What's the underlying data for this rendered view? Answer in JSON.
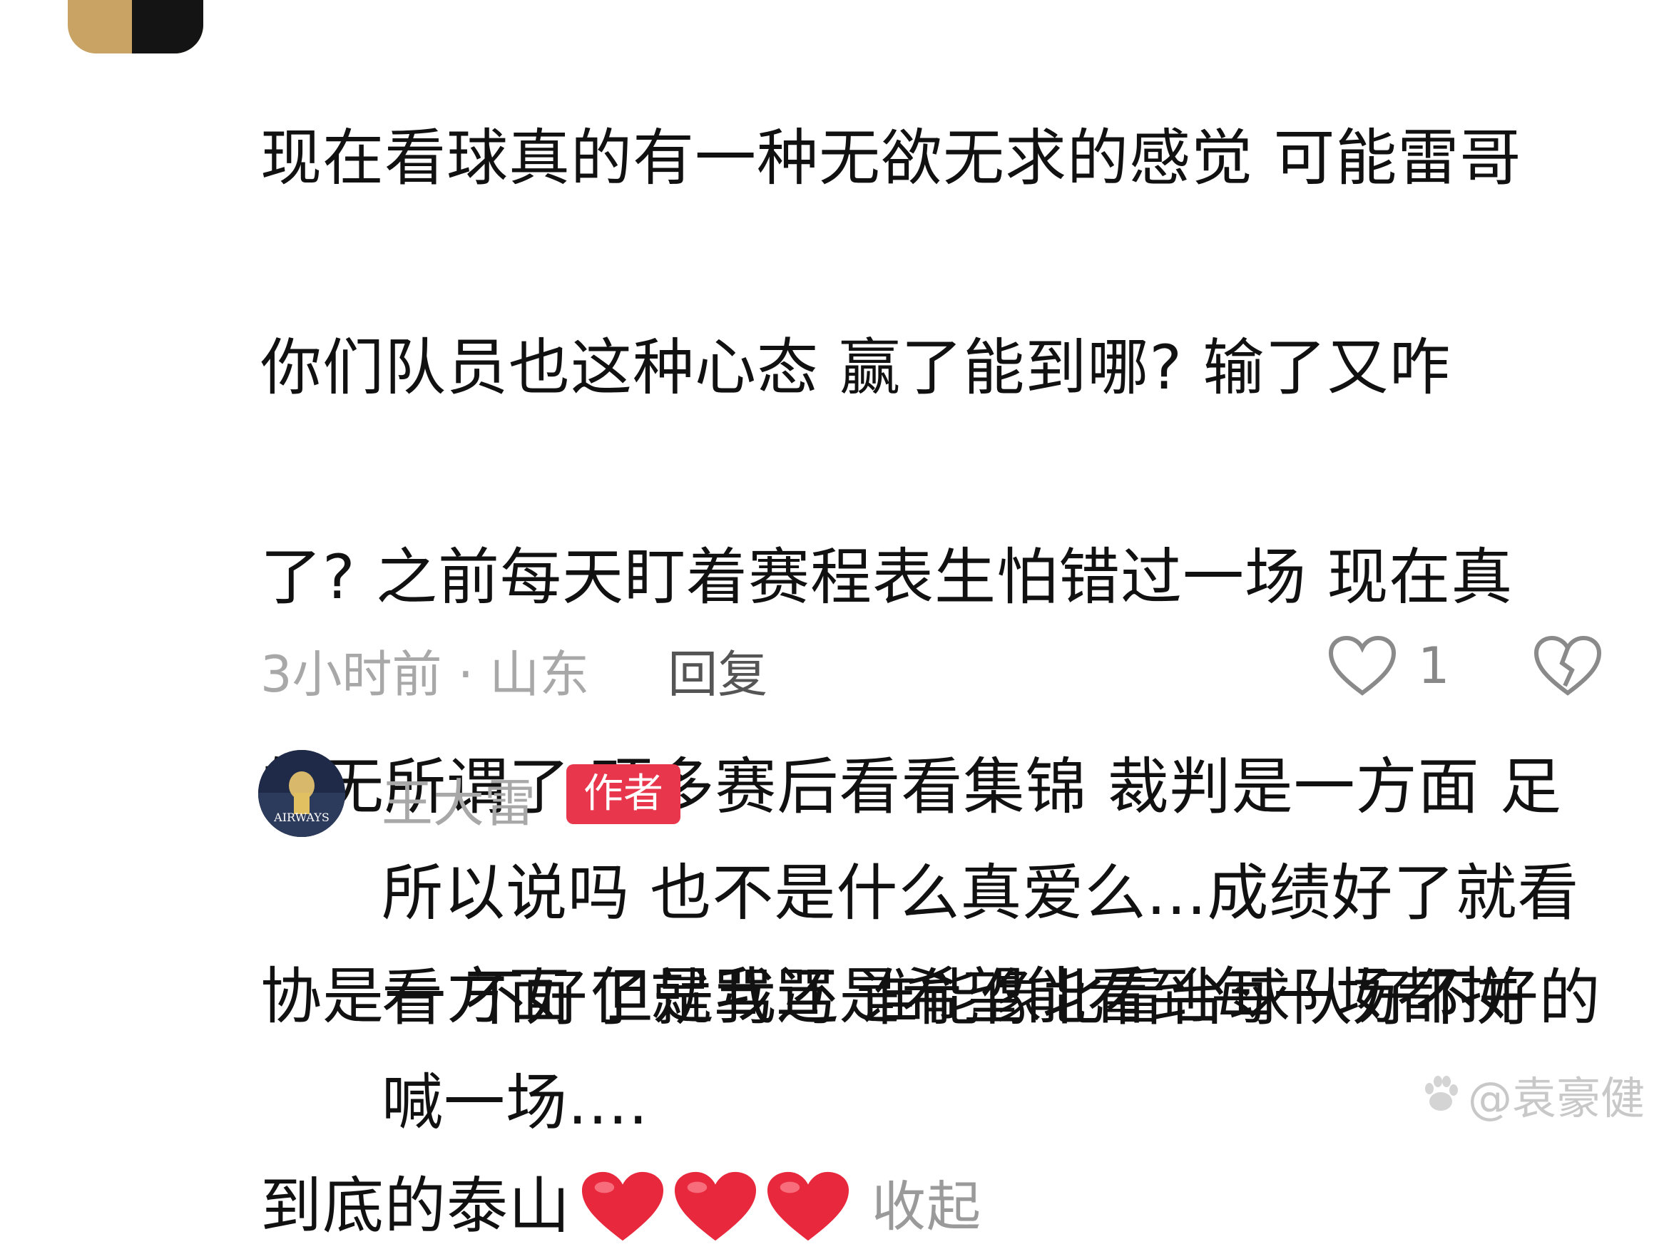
{
  "comment": {
    "lines": [
      "现在看球真的有一种无欲无求的感觉 可能雷哥",
      "你们队员也这种心态  赢了能到哪? 输了又咋",
      "了? 之前每天盯着赛程表生怕错过一场 现在真",
      "的无所谓了 顶多赛后看看集锦 裁判是一方面 足",
      "协是一方面 但是我还是希望能看到每一场都拼"
    ],
    "last_line": "到底的泰山",
    "collapse_label": "收起",
    "time_location": "3小时前 · 山东",
    "reply_label": "回复",
    "like_count": "1",
    "heart_color": "#e8283c"
  },
  "reply": {
    "author": "王大雷",
    "badge": "作者",
    "badge_color": "#e8364c",
    "avatar_text": "AIRWAYS",
    "text": "所以说吗 也不是什么真爱么...成绩好了就看看 不好了就骂骂 谁能像北看台球队好不好的喊一场...."
  },
  "watermark": {
    "text": "@袁豪健"
  }
}
